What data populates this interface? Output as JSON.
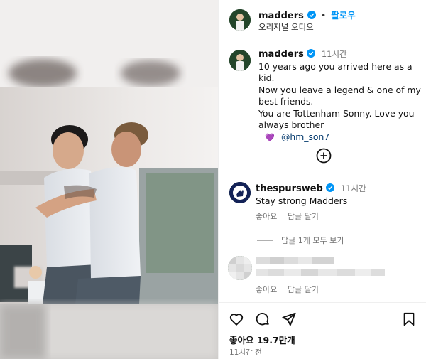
{
  "post": {
    "author": "madders",
    "follow_label": "팔로우",
    "separator": "•",
    "audio": "오리지널 오디오",
    "caption_time": "11시간",
    "caption_lines": [
      "10 years ago you arrived here as a kid.",
      "Now you leave a legend & one of my",
      "best friends.",
      "You are Tottenham Sonny. Love you",
      "always brother"
    ],
    "mention": "@hm_son7",
    "heart_glyph": "💜",
    "likes": "좋아요 19.7만개",
    "posted_ago": "11시간 전"
  },
  "comments": [
    {
      "user": "thespursweb",
      "time": "11시간",
      "text": "Stay strong Madders",
      "like_label": "좋아요",
      "reply_label": "답글 달기",
      "view_replies": "답글 1개 모두 보기"
    },
    {
      "user": "",
      "text": "",
      "like_label": "좋아요",
      "reply_label": "답글 달기"
    }
  ],
  "icons": {
    "verified": "verified-badge-icon",
    "more": "add-circle-icon",
    "like": "heart-icon",
    "comment": "comment-icon",
    "share": "paper-plane-icon",
    "save": "bookmark-icon"
  },
  "colors": {
    "link_blue": "#0095f6",
    "verified_blue": "#0095f6",
    "muted": "#737373",
    "mention": "#00376b"
  }
}
